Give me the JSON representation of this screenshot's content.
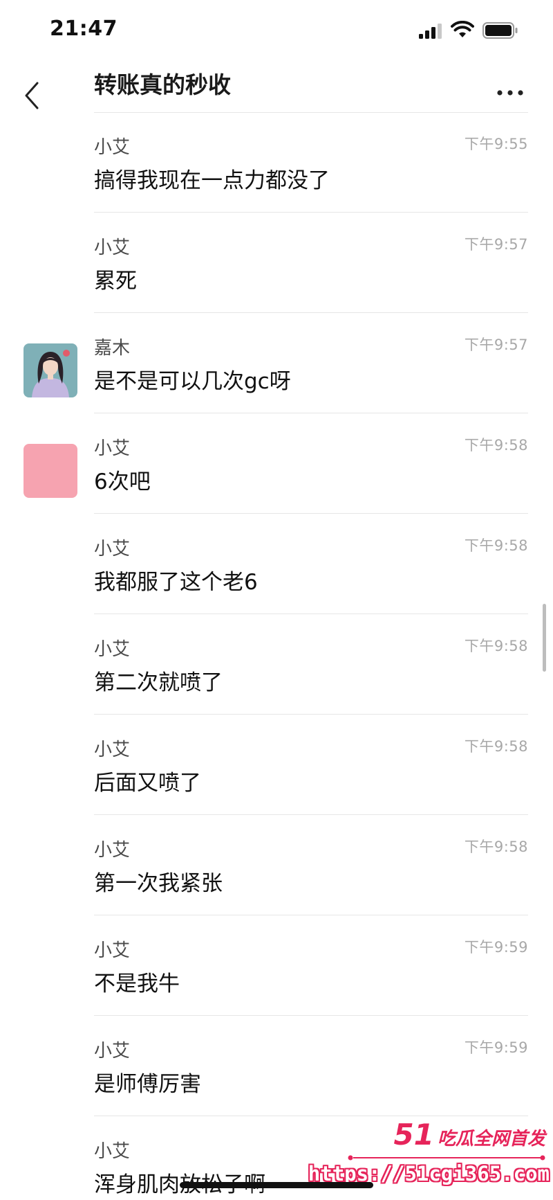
{
  "status_bar": {
    "time": "21:47"
  },
  "nav": {
    "title": "转账真的秒收"
  },
  "messages": [
    {
      "sender": "小艾",
      "time": "下午9:55",
      "text": "搞得我现在一点力都没了",
      "avatar": "none"
    },
    {
      "sender": "小艾",
      "time": "下午9:57",
      "text": "累死",
      "avatar": "none"
    },
    {
      "sender": "嘉木",
      "time": "下午9:57",
      "text": "是不是可以几次gc呀",
      "avatar": "girl-portrait"
    },
    {
      "sender": "小艾",
      "time": "下午9:58",
      "text": "6次吧",
      "avatar": "pink-square"
    },
    {
      "sender": "小艾",
      "time": "下午9:58",
      "text": "我都服了这个老6",
      "avatar": "none"
    },
    {
      "sender": "小艾",
      "time": "下午9:58",
      "text": "第二次就喷了",
      "avatar": "none"
    },
    {
      "sender": "小艾",
      "time": "下午9:58",
      "text": "后面又喷了",
      "avatar": "none"
    },
    {
      "sender": "小艾",
      "time": "下午9:58",
      "text": "第一次我紧张",
      "avatar": "none"
    },
    {
      "sender": "小艾",
      "time": "下午9:59",
      "text": "不是我牛",
      "avatar": "none"
    },
    {
      "sender": "小艾",
      "time": "下午9:59",
      "text": "是师傅厉害",
      "avatar": "none"
    },
    {
      "sender": "小艾",
      "time": "",
      "text": "浑身肌肉放松子啊",
      "avatar": "none"
    }
  ],
  "watermark": {
    "number": "51",
    "slogan": "吃瓜全网首发",
    "url": "https://51cgi365.com"
  },
  "colors": {
    "accent": "#e6245a",
    "divider": "#e6e6e6",
    "time_text": "#a8a8a8",
    "pink_avatar": "#f6a3b0"
  },
  "icons": [
    "signal-icon",
    "wifi-icon",
    "battery-icon",
    "back-chevron-icon",
    "more-dots-icon"
  ]
}
